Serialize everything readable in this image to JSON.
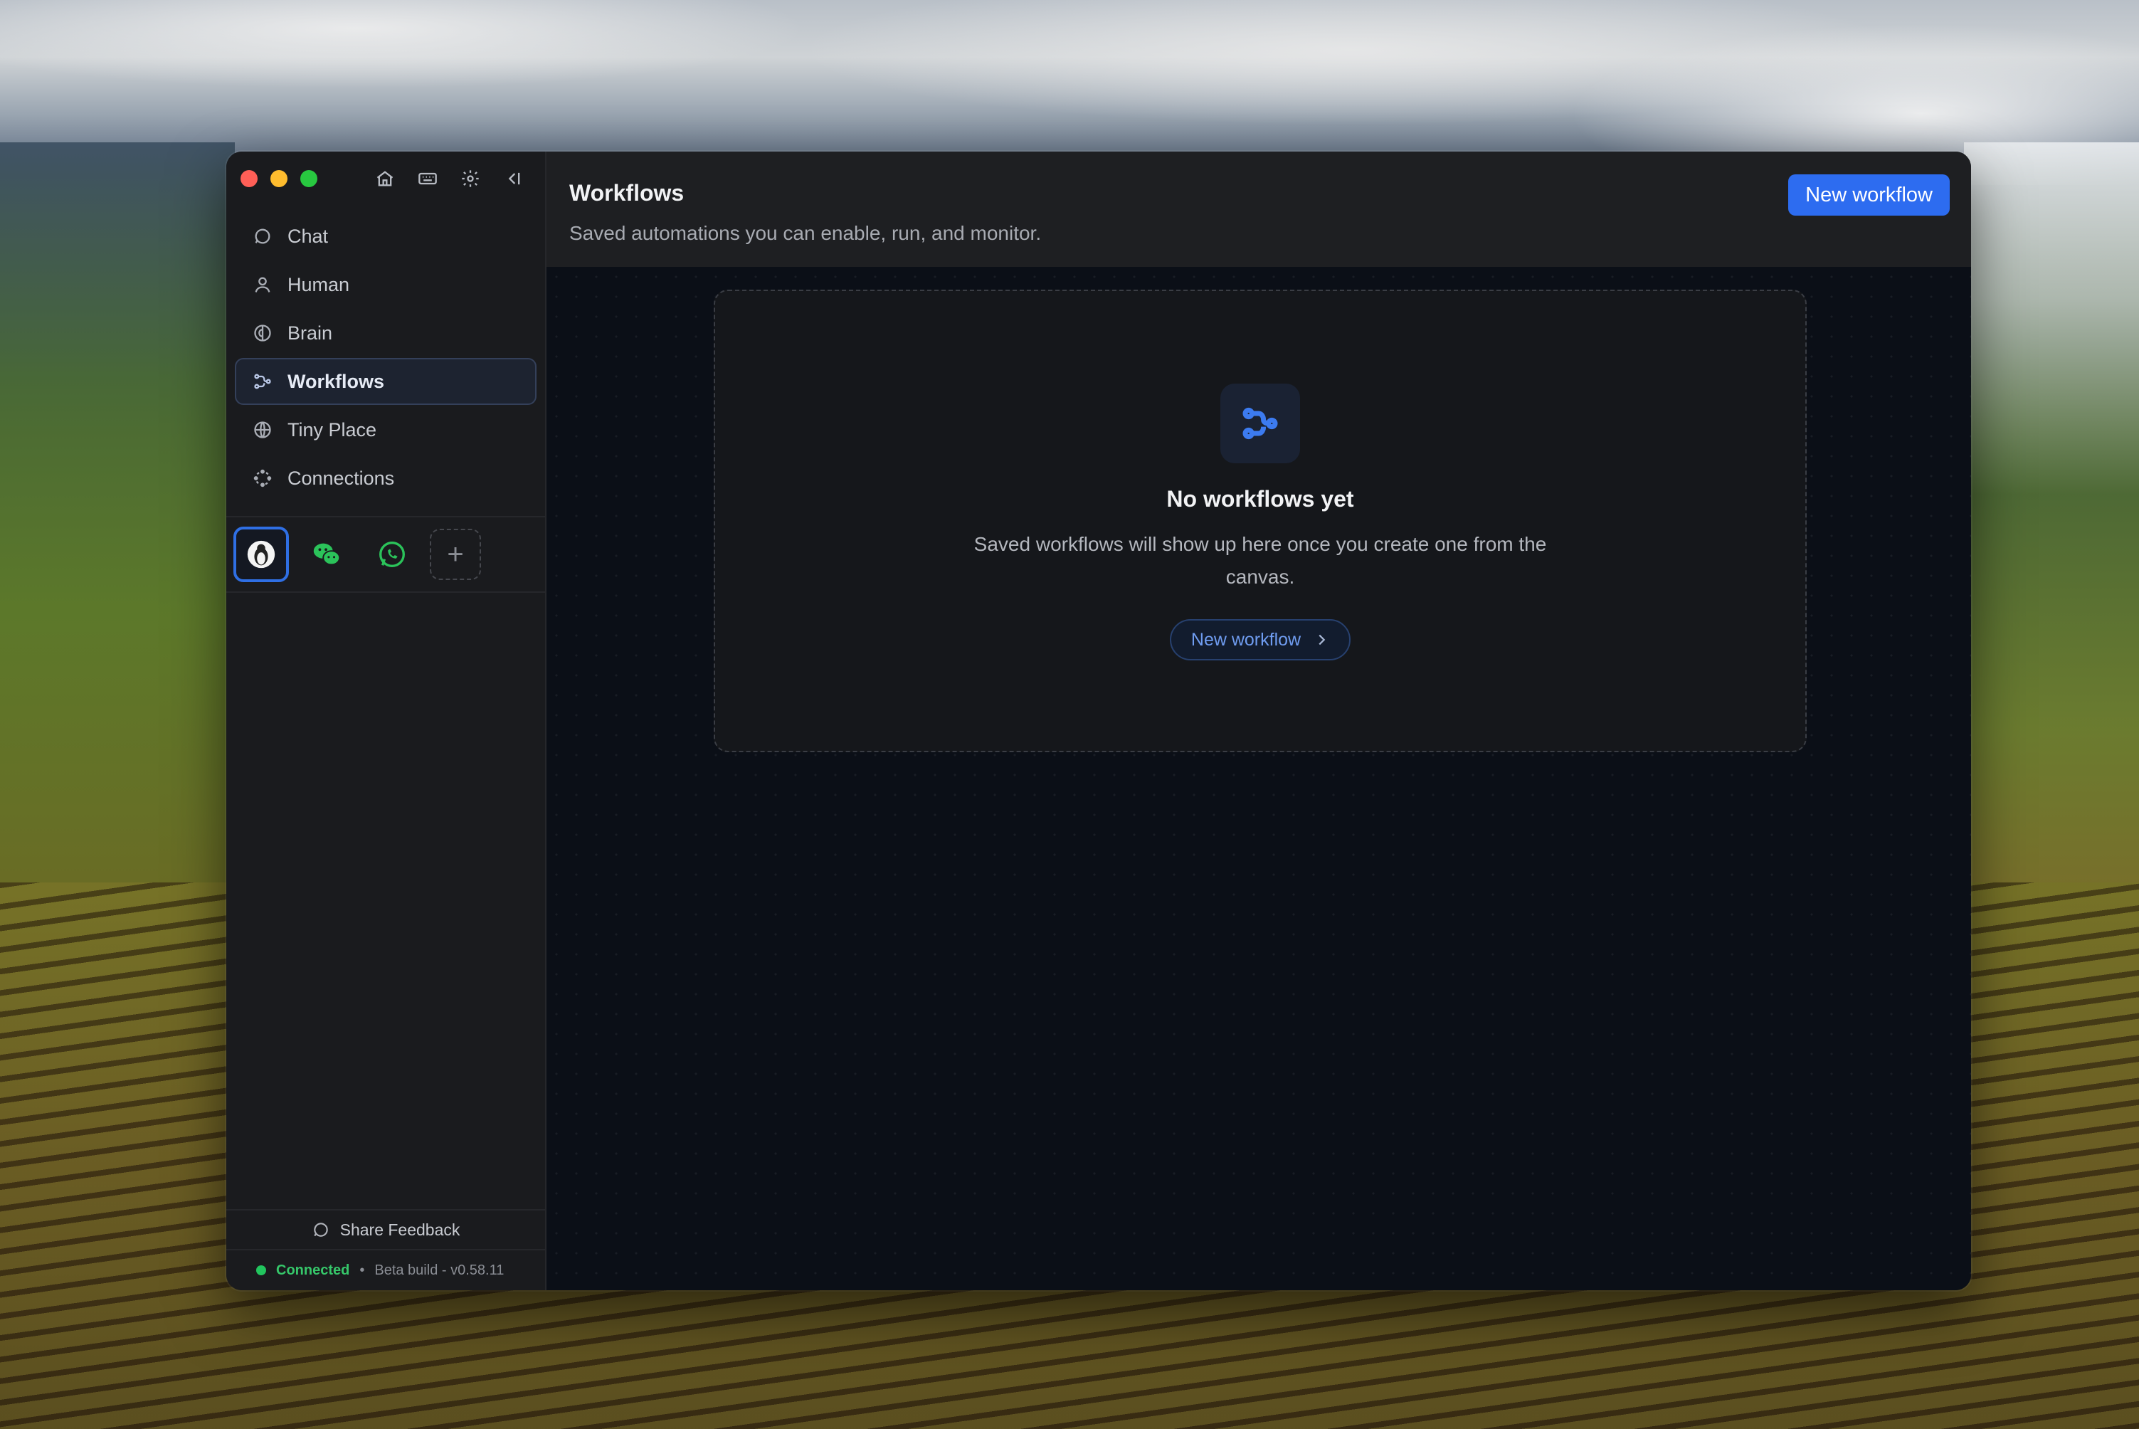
{
  "sidebar": {
    "nav": [
      {
        "label": "Chat",
        "icon": "chat-bubble-icon"
      },
      {
        "label": "Human",
        "icon": "person-icon"
      },
      {
        "label": "Brain",
        "icon": "brain-icon"
      },
      {
        "label": "Workflows",
        "icon": "workflow-icon",
        "active": true
      },
      {
        "label": "Tiny Place",
        "icon": "globe-icon"
      },
      {
        "label": "Connections",
        "icon": "connections-icon"
      }
    ],
    "apps": [
      "app-penguin",
      "wechat",
      "whatsapp",
      "add"
    ],
    "feedback_label": "Share Feedback",
    "status": {
      "connected": "Connected",
      "separator": "•",
      "build": "Beta build - v0.58.11"
    }
  },
  "header": {
    "title": "Workflows",
    "subtitle": "Saved automations you can enable, run, and monitor.",
    "new_button": "New workflow"
  },
  "empty_state": {
    "title": "No workflows yet",
    "description": "Saved workflows will show up here once you create one from the canvas.",
    "button": "New workflow"
  },
  "colors": {
    "accent": "#2d6cf0",
    "connected": "#22c55e",
    "close": "#ff5f57",
    "minimize": "#febc2e",
    "zoom": "#28c840"
  }
}
